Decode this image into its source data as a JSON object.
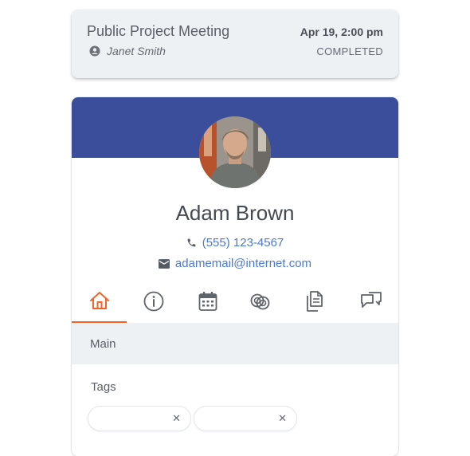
{
  "meeting": {
    "title": "Public Project Meeting",
    "host": "Janet Smith",
    "date": "Apr 19, 2:00 pm",
    "status": "COMPLETED"
  },
  "profile": {
    "name": "Adam Brown",
    "phone": "(555) 123-4567",
    "email": "adamemail@internet.com"
  },
  "tabs": [
    {
      "icon": "home-icon",
      "active": true
    },
    {
      "icon": "info-icon",
      "active": false
    },
    {
      "icon": "calendar-icon",
      "active": false
    },
    {
      "icon": "rings-icon",
      "active": false
    },
    {
      "icon": "documents-icon",
      "active": false
    },
    {
      "icon": "chat-icon",
      "active": false
    }
  ],
  "sections": {
    "main_label": "Main",
    "tags_label": "Tags"
  },
  "tags": [
    {
      "label": "",
      "remove_glyph": "✕"
    },
    {
      "label": "",
      "remove_glyph": "✕"
    }
  ],
  "colors": {
    "banner": "#3b4e9c",
    "accent": "#f0632a",
    "link": "#4b78d1"
  }
}
